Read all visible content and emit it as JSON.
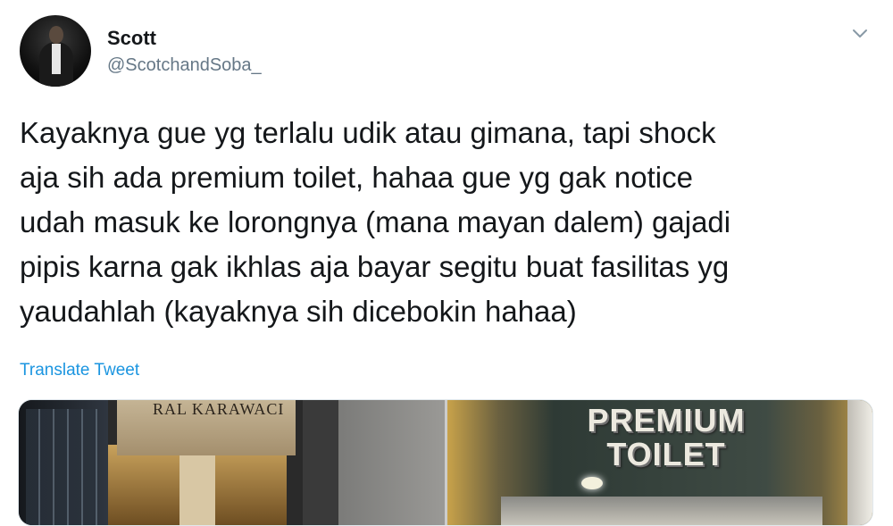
{
  "tweet": {
    "author_name": "Scott",
    "author_handle": "@ScotchandSoba_",
    "text_lines": [
      "Kayaknya gue yg terlalu udik atau gimana, tapi shock",
      "aja sih ada premium toilet, hahaa gue yg gak notice",
      "udah masuk ke lorongnya (mana mayan dalem) gajadi",
      "pipis karna gak ikhlas aja bayar segitu buat fasilitas yg",
      "yaudahlah (kayaknya sih dicebokin hahaa)"
    ],
    "translate_label": "Translate Tweet",
    "menu_icon": "chevron-down-icon"
  },
  "media": {
    "photos": [
      {
        "sign_text": "RAL KARAWACI"
      },
      {
        "sign_line1": "PREMIUM",
        "sign_line2": "TOILET"
      }
    ]
  },
  "colors": {
    "text": "#14171a",
    "secondary": "#657786",
    "link": "#1b95e0"
  }
}
